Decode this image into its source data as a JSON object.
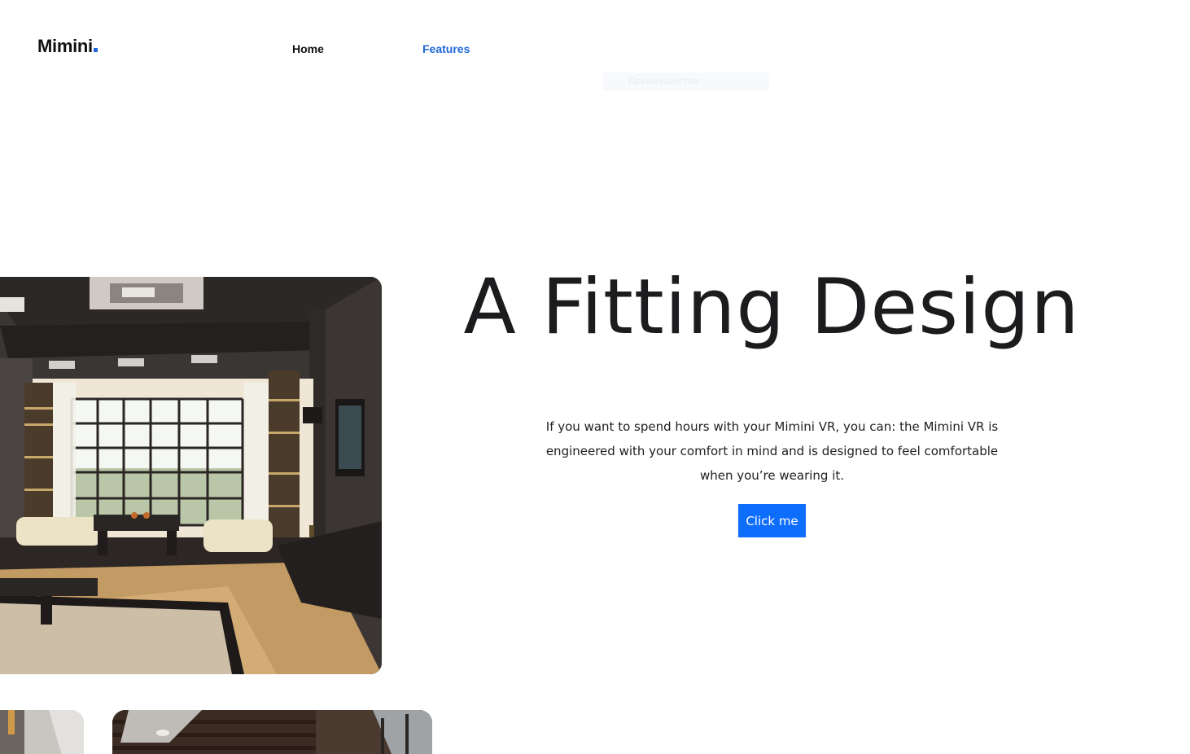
{
  "header": {
    "logo_text": "Mimini",
    "nav": {
      "home_label": "Home",
      "features_label": "Features"
    },
    "ghost_dropdown_text": "Преимущества"
  },
  "hero": {
    "title": "A Fitting Design",
    "description": "If you want to spend hours with your Mimini VR, you can: the Mimini VR is engineered with your comfort in mind and is designed to feel comfortable when you’re wearing it.",
    "button_label": "Click me"
  },
  "colors": {
    "accent": "#1f67d8",
    "button": "#0d6efd",
    "text": "#1c1c1e"
  },
  "images": {
    "hero_image": "living-room-interior-photo",
    "thumb_1": "interior-photo",
    "thumb_2": "interior-photo"
  }
}
